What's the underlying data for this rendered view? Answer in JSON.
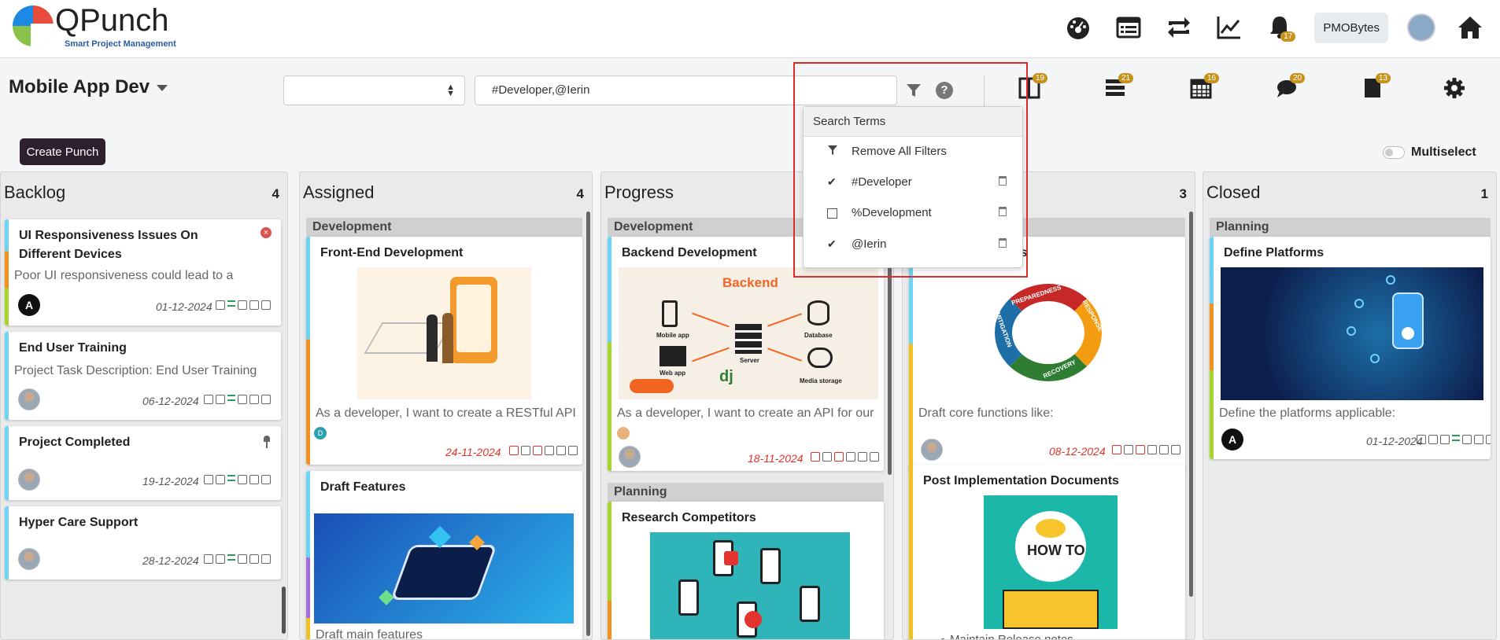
{
  "header": {
    "brand": "QPunch",
    "tagline": "Smart Project Management",
    "user_label": "PMOBytes",
    "notification_count": "17",
    "icons": [
      "dashboard-icon",
      "list-icon",
      "sync-icon",
      "chart-icon",
      "bell-icon",
      "avatar",
      "home-icon"
    ]
  },
  "project": {
    "title": "Mobile App Dev",
    "select_value": "",
    "search_value": "#Developer,@Ierin",
    "toolbar": [
      {
        "icon": "board-icon",
        "count": "19"
      },
      {
        "icon": "list-icon",
        "count": "21"
      },
      {
        "icon": "calendar-icon",
        "count": "16"
      },
      {
        "icon": "chat-icon",
        "count": "20"
      },
      {
        "icon": "file-icon",
        "count": "13"
      },
      {
        "icon": "gear-icon",
        "count": ""
      }
    ]
  },
  "actions": {
    "create_label": "Create Punch",
    "multiselect_label": "Multiselect"
  },
  "search_terms": {
    "title": "Search Terms",
    "remove_all": "Remove All Filters",
    "items": [
      {
        "label": "#Developer",
        "checked": true
      },
      {
        "label": "%Development",
        "checked": false
      },
      {
        "label": "@Ierin",
        "checked": true
      }
    ]
  },
  "columns": [
    {
      "name": "Backlog",
      "count": "4",
      "cards": [
        {
          "title_line1": "UI Responsiveness Issues On",
          "title_line2": "Different Devices",
          "desc": "Poor UI responsiveness could lead to a",
          "date": "01-12-2024"
        },
        {
          "title": "End User Training",
          "desc": "Project Task Description: End User Training",
          "date": "06-12-2024"
        },
        {
          "title": "Project Completed",
          "date": "19-12-2024"
        },
        {
          "title": "Hyper Care Support",
          "date": "28-12-2024"
        }
      ]
    },
    {
      "name": "Assigned",
      "count": "4",
      "groups": [
        "Development"
      ],
      "cards": [
        {
          "title": "Front-End Development",
          "desc": "As a developer, I want to create a RESTful API",
          "date": "24-11-2024"
        },
        {
          "title": "Draft Features",
          "desc": "Draft main features"
        }
      ]
    },
    {
      "name": "Progress",
      "count": "",
      "groups": [
        "Development",
        "Planning"
      ],
      "cards": [
        {
          "title": "Backend Development",
          "desc": "As a developer, I want to create an API for our",
          "date": "18-11-2024"
        },
        {
          "title": "Research Competitors"
        }
      ],
      "backend_image": {
        "title": "Backend",
        "labels": [
          "Mobile app",
          "Server",
          "Database",
          "Web app",
          "Media storage"
        ]
      }
    },
    {
      "name": "",
      "count": "3",
      "cards": [
        {
          "title": "ons",
          "desc": "Draft core functions like:",
          "date": "08-12-2024"
        },
        {
          "title": "Post Implementation Documents",
          "bullet": "Maintain Release notes"
        }
      ],
      "cycle_labels": [
        "PREPAREDNESS",
        "RESPONSE",
        "RECOVERY",
        "MITIGATION"
      ],
      "howto_label": "HOW TO"
    },
    {
      "name": "Closed",
      "count": "1",
      "groups": [
        "Planning"
      ],
      "cards": [
        {
          "title": "Define Platforms",
          "desc": "Define the platforms applicable:",
          "date": "01-12-2024"
        }
      ]
    }
  ],
  "colors": {
    "accent": "#c6921c",
    "create_button": "#2e1f2f",
    "highlight_box": "#e02b2b",
    "overdue_date": "#e0332b"
  }
}
